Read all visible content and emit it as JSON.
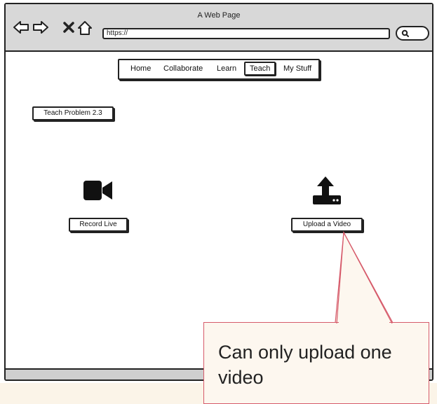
{
  "window": {
    "title": "A Web Page",
    "url": "https://"
  },
  "menu": {
    "items": [
      "Home",
      "Collaborate",
      "Learn",
      "Teach",
      "My Stuff"
    ],
    "active": "Teach"
  },
  "page": {
    "section_button": "Teach Problem 2.3",
    "record_button": "Record Live",
    "upload_button": "Upload a Video"
  },
  "icons": {
    "back": "arrow-left-icon",
    "forward": "arrow-right-icon",
    "stop": "close-icon",
    "home": "home-icon",
    "search": "search-icon",
    "record": "video-camera-icon",
    "upload": "upload-icon"
  },
  "callout": {
    "text": "Can only upload one video",
    "border_color": "#d65a6a",
    "background_color": "#fdf7ef"
  }
}
